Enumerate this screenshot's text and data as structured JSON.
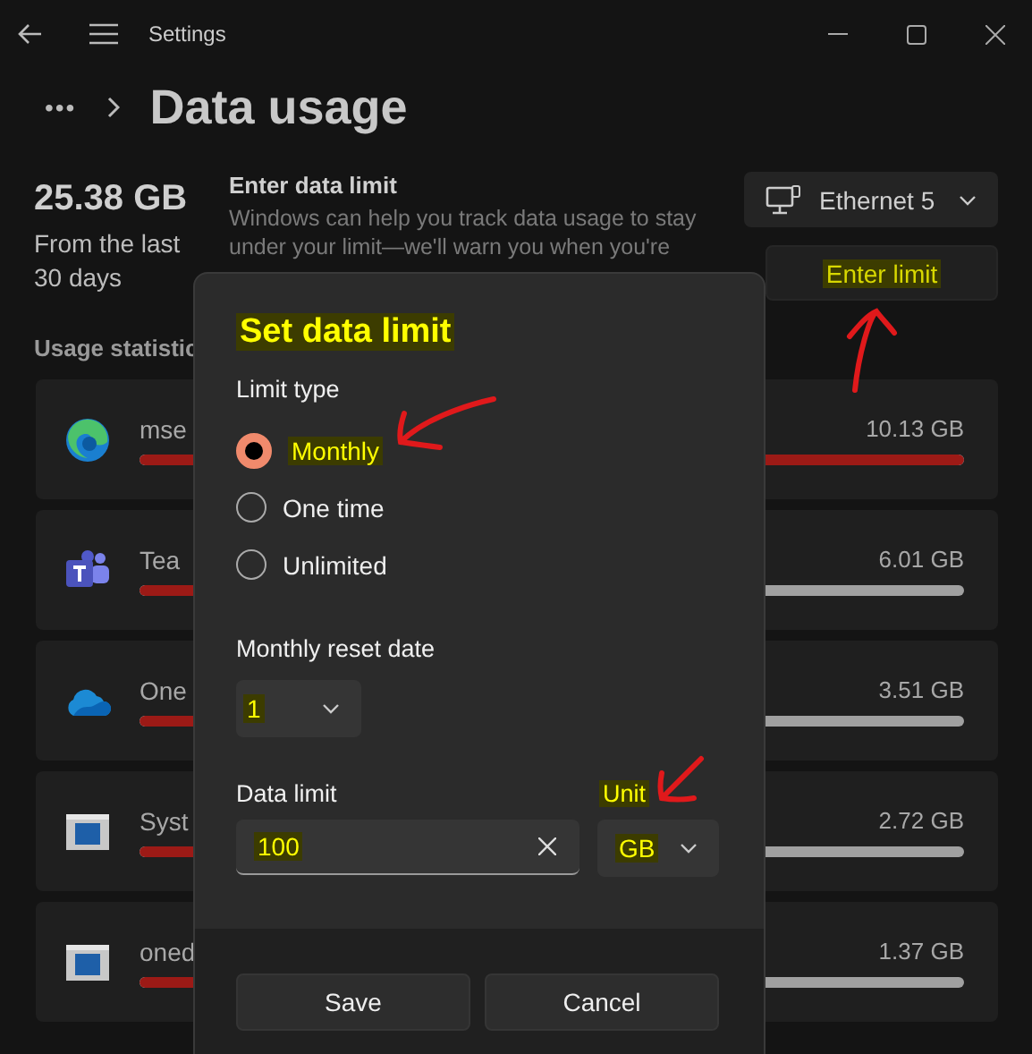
{
  "window": {
    "title": "Settings"
  },
  "breadcrumb": {
    "overflow": "•••",
    "page": "Data usage"
  },
  "summary": {
    "total": "25.38 GB",
    "period": "From the last 30 days"
  },
  "data_limit": {
    "heading": "Enter data limit",
    "description": "Windows can help you track data usage to stay under your limit—we'll warn you when you're",
    "network": "Ethernet 5",
    "button": {
      "text": "Enter limit",
      "highlighted": true
    }
  },
  "usage": {
    "heading": "Usage statistic",
    "apps": [
      {
        "kind": "sphere",
        "name": "mse",
        "amount": "10.13 GB",
        "level": 1
      },
      {
        "kind": "tile",
        "name": "Tea",
        "amount": "6.01 GB",
        "level": 0.59
      },
      {
        "kind": "cloud",
        "name": "One",
        "amount": "3.51 GB",
        "level": 0.35
      },
      {
        "kind": "window",
        "name": "Syst",
        "amount": "2.72 GB",
        "level": 0.27
      },
      {
        "kind": "window",
        "name": "oned",
        "amount": "1.37 GB",
        "level": 0.14
      }
    ]
  },
  "dialog": {
    "title": {
      "text": "Set data limit",
      "highlighted": true
    },
    "limit_type_label": "Limit type",
    "limit_types": [
      {
        "label": "Monthly",
        "selected": true,
        "highlighted": true
      },
      {
        "label": "One time",
        "selected": false,
        "highlighted": false
      },
      {
        "label": "Unlimited",
        "selected": false,
        "highlighted": false
      }
    ],
    "reset_label": "Monthly reset date",
    "reset_date": {
      "value": "1",
      "highlighted": true
    },
    "limit_label": "Data limit",
    "unit_label": {
      "text": "Unit",
      "highlighted": true
    },
    "limit_value": {
      "value": "100",
      "highlighted": true
    },
    "unit": {
      "value": "GB",
      "highlighted": true
    },
    "buttons": [
      "Save",
      "Cancel"
    ]
  }
}
